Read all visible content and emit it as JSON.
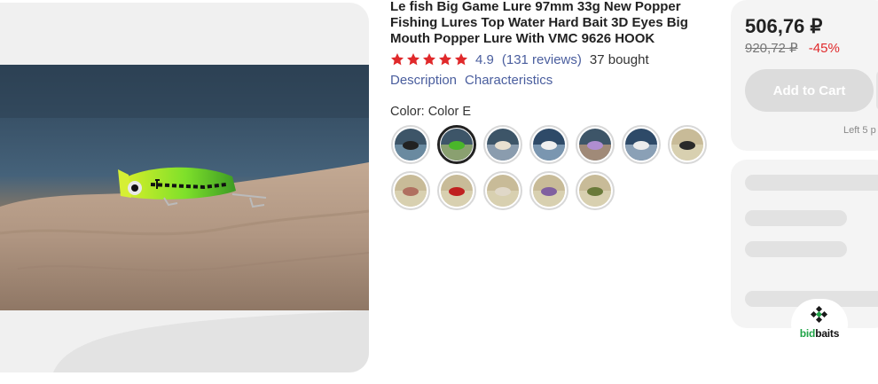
{
  "product": {
    "title": "Le fish Big Game Lure 97mm 33g New Popper Fishing Lures Top Water Hard Bait 3D Eyes Big Mouth Popper Lure With VMC 9626 HOOK",
    "rating": "4.9",
    "rating_value": 4.9,
    "stars_filled": 5,
    "reviews": "(131 reviews)",
    "bought": "37 bought",
    "tabs": [
      "Description",
      "Characteristics"
    ]
  },
  "color": {
    "label": "Color: Color E",
    "selected_index": 1,
    "swatch_count": 12
  },
  "buy": {
    "price": "506,76 ₽",
    "old_price": "920,72 ₽",
    "discount": "-45%",
    "add_to_cart": "Add to Cart",
    "left_text": "Left 5 p"
  },
  "logo": {
    "part1": "bid",
    "part2": "baits"
  },
  "colors": {
    "accent": "#e0292b",
    "link": "#4a5e9e",
    "star": "#e0292b",
    "logo_green": "#1fa447"
  },
  "icons": [
    "star-icon",
    "bidbaits-logo-icon"
  ]
}
